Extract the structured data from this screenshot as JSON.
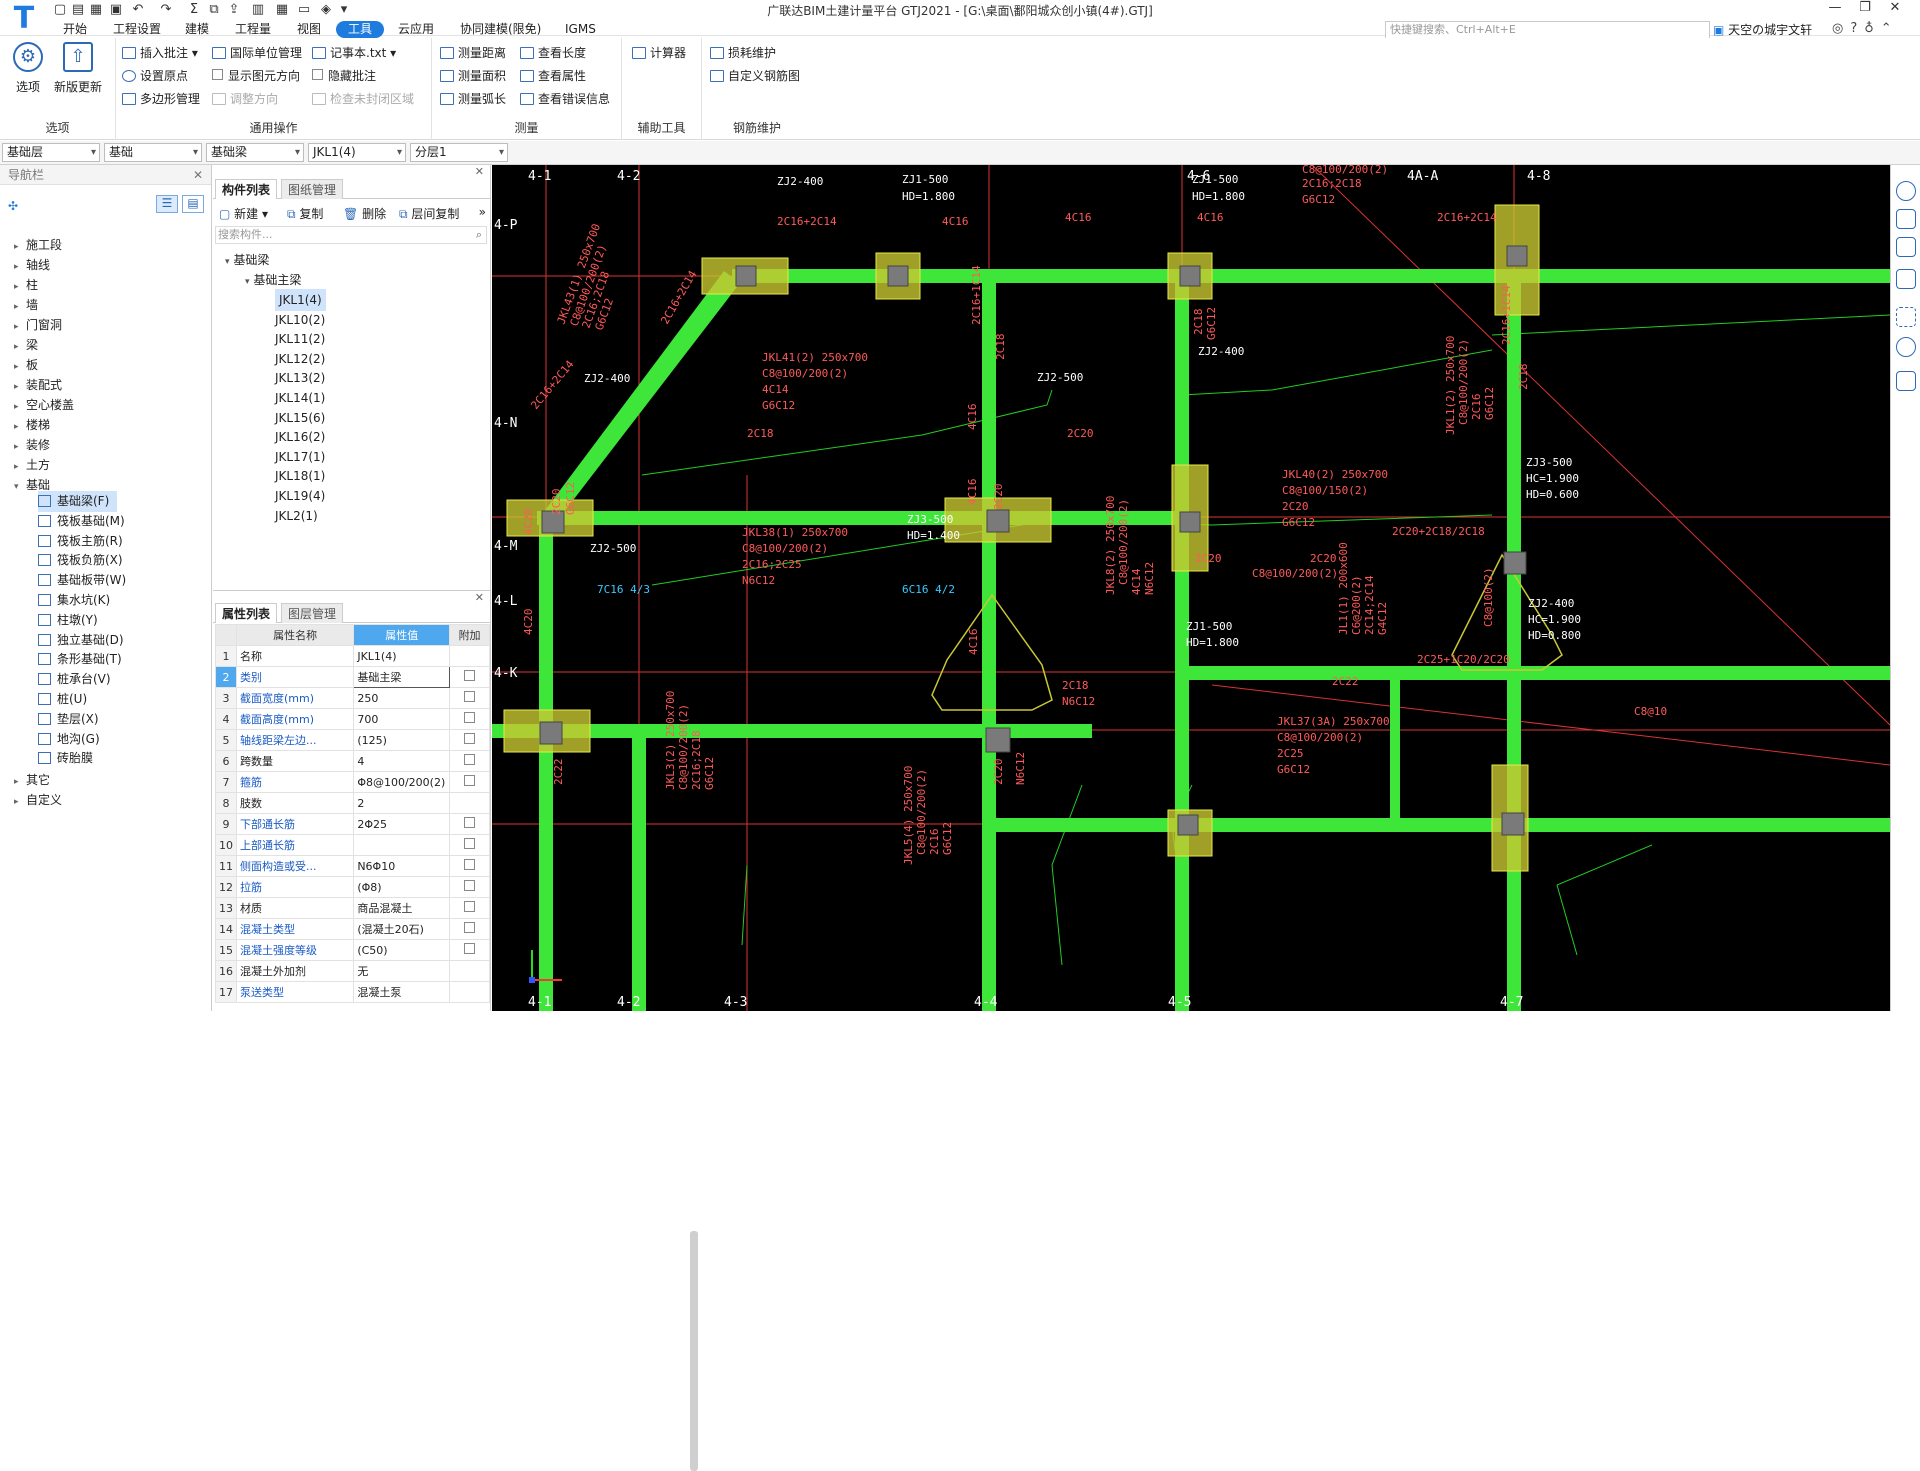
{
  "app": {
    "title": "广联达BIM土建计量平台 GTJ2021 - [G:\\桌面\\鄱阳城众创小镇(4#).GTJ]",
    "search_placeholder": "快捷键搜索、Ctrl+Alt+E",
    "user": "天空の城宇文轩"
  },
  "menus": [
    "开始",
    "工程设置",
    "建模",
    "工程量",
    "视图",
    "工具",
    "云应用",
    "协同建模(限免)",
    "IGMS"
  ],
  "ribbon": {
    "groups": {
      "options": "选项",
      "general": "通用操作",
      "measure": "测量",
      "aux": "辅助工具",
      "rebar": "钢筋维护"
    },
    "big": {
      "options": "选项",
      "update": "新版更新"
    },
    "general_items": [
      "插入批注",
      "国际单位管理",
      "记事本.txt",
      "设置原点",
      "显示图元方向",
      "隐藏批注",
      "多边形管理",
      "调整方向",
      "检查未封闭区域"
    ],
    "measure_items": [
      "测量距离",
      "查看长度",
      "测量面积",
      "查看属性",
      "测量弧长",
      "查看错误信息"
    ],
    "aux_items": [
      "计算器"
    ],
    "rebar_items": [
      "损耗维护",
      "自定义钢筋图"
    ]
  },
  "filters": [
    "基础层",
    "基础",
    "基础梁",
    "JKL1(4)",
    "分层1"
  ],
  "nav": {
    "header": "导航栏",
    "items": [
      "施工段",
      "轴线",
      "柱",
      "墙",
      "门窗洞",
      "梁",
      "板",
      "装配式",
      "空心楼盖",
      "楼梯",
      "装修",
      "土方",
      "基础",
      "其它",
      "自定义"
    ],
    "sub_items": [
      "基础梁(F)",
      "筏板基础(M)",
      "筏板主筋(R)",
      "筏板负筋(X)",
      "基础板带(W)",
      "集水坑(K)",
      "柱墩(Y)",
      "独立基础(D)",
      "条形基础(T)",
      "桩承台(V)",
      "桩(U)",
      "垫层(X)",
      "地沟(G)",
      "砖胎膜"
    ]
  },
  "components": {
    "tabs": [
      "构件列表",
      "图纸管理"
    ],
    "toolbar": [
      "新建",
      "复制",
      "删除",
      "层间复制"
    ],
    "search_placeholder": "搜索构件...",
    "root": "基础梁",
    "group": "基础主梁",
    "items": [
      "JKL1(4)",
      "JKL10(2)",
      "JKL11(2)",
      "JKL12(2)",
      "JKL13(2)",
      "JKL14(1)",
      "JKL15(6)",
      "JKL16(2)",
      "JKL17(1)",
      "JKL18(1)",
      "JKL19(4)",
      "JKL2(1)"
    ]
  },
  "properties": {
    "tabs": [
      "属性列表",
      "图层管理"
    ],
    "headers": [
      "属性名称",
      "属性值",
      "附加"
    ],
    "rows": [
      {
        "n": "1",
        "k": "名称",
        "v": "JKL1(4)",
        "cb": false
      },
      {
        "n": "2",
        "k": "类别",
        "v": "基础主梁",
        "cb": true
      },
      {
        "n": "3",
        "k": "截面宽度(mm)",
        "v": "250",
        "cb": true
      },
      {
        "n": "4",
        "k": "截面高度(mm)",
        "v": "700",
        "cb": true
      },
      {
        "n": "5",
        "k": "轴线距梁左边...",
        "v": "(125)",
        "cb": true
      },
      {
        "n": "6",
        "k": "跨数量",
        "v": "4",
        "cb": true
      },
      {
        "n": "7",
        "k": "箍筋",
        "v": "Φ8@100/200(2)",
        "cb": true
      },
      {
        "n": "8",
        "k": "肢数",
        "v": "2",
        "cb": false
      },
      {
        "n": "9",
        "k": "下部通长筋",
        "v": "2Φ25",
        "cb": true
      },
      {
        "n": "10",
        "k": "上部通长筋",
        "v": "",
        "cb": true
      },
      {
        "n": "11",
        "k": "侧面构造或受...",
        "v": "N6Φ10",
        "cb": true
      },
      {
        "n": "12",
        "k": "拉筋",
        "v": "(Φ8)",
        "cb": true
      },
      {
        "n": "13",
        "k": "材质",
        "v": "商品混凝土",
        "cb": true
      },
      {
        "n": "14",
        "k": "混凝土类型",
        "v": "(混凝土20石)",
        "cb": true
      },
      {
        "n": "15",
        "k": "混凝土强度等级",
        "v": "(C50)",
        "cb": true
      },
      {
        "n": "16",
        "k": "混凝土外加剂",
        "v": "无",
        "cb": false
      },
      {
        "n": "17",
        "k": "泵送类型",
        "v": "混凝土泵",
        "cb": false
      }
    ]
  },
  "cad": {
    "axes_top": [
      "4-1",
      "4-2",
      "4-6",
      "4A-A",
      "4-8"
    ],
    "axes_bottom": [
      "4-1",
      "4-2",
      "4-3",
      "4-4",
      "4-5",
      "4-7"
    ],
    "axes_left": [
      "4-P",
      "4-N",
      "4-M",
      "4-L",
      "4-K"
    ],
    "labels": [
      "ZJ2-400",
      "ZJ1-500",
      "HD=1.800",
      "ZJ1-500",
      "HD=1.800",
      "JKL44(4) 250x700",
      "C8@100/200(2)",
      "2C16;2C18",
      "G6C12",
      "2C16+2C14",
      "4C16",
      "4C16",
      "4C16",
      "2C16+2C14",
      "JKL43(1) 250x700",
      "C8@100/200(2)",
      "2C16;2C18",
      "G6C12",
      "2C16+2C14",
      "2C16+1C14",
      "2C18",
      "2C18",
      "G6C12",
      "2C16+1C14",
      "JKL41(2) 250x700",
      "C8@100/200(2)",
      "4C14",
      "G6C12",
      "2C16+2C14",
      "ZJ2-400",
      "ZJ2-500",
      "ZJ2-400",
      "4C16",
      "2C18",
      "2C20",
      "JKL1(2) 250x700",
      "C8@100/200(2)",
      "2C16",
      "G6C12",
      "2C18",
      "JKL40(2) 250x700",
      "C8@100/150(2)",
      "2C20",
      "G6C12",
      "ZJ3-500",
      "HC=1.900",
      "HD=0.600",
      "JKL38(1) 250x700",
      "C8@100/200(2)",
      "2C16;2C25",
      "N6C12",
      "ZJ3-500",
      "HD=1.400",
      "4C16",
      "2C20",
      "4C20",
      "2C20",
      "G6C12",
      "ZJ2-500",
      "2C20+2C18/2C18",
      "2C20",
      "C8@100/200(2)",
      "2C20",
      "JKL8(2) 250x700",
      "C8@100/200(2)",
      "4C14",
      "N6C12",
      "7C16 4/3",
      "6C16 4/2",
      "JL1(1) 200x600",
      "C6@200(2)",
      "2C14;2C14",
      "G4C12",
      "C8@100(2)",
      "ZJ2-400",
      "HC=1.900",
      "HD=0.800",
      "ZJ1-500",
      "HD=1.800",
      "4C20",
      "4C16",
      "2C25+1C20/2C20",
      "2C18",
      "N6C12",
      "2C22",
      "JKL37(3A) 250x700",
      "C8@100/200(2)",
      "2C25",
      "G6C12",
      "C8@10",
      "JKL3(2) 250x700",
      "C8@100/200(2)",
      "2C16;2C18",
      "G6C12",
      "2C22",
      "JKL5(4) 250x700",
      "C8@100/200(2)",
      "2C16",
      "G6C12",
      "2C20",
      "N6C12"
    ]
  },
  "colors": {
    "accent": "#1d7cde",
    "beam": "#3ee63a",
    "canvas": "#000000",
    "cad_red": "#ff4d4d",
    "cad_green": "#26d926",
    "cap": "#c8c832"
  }
}
